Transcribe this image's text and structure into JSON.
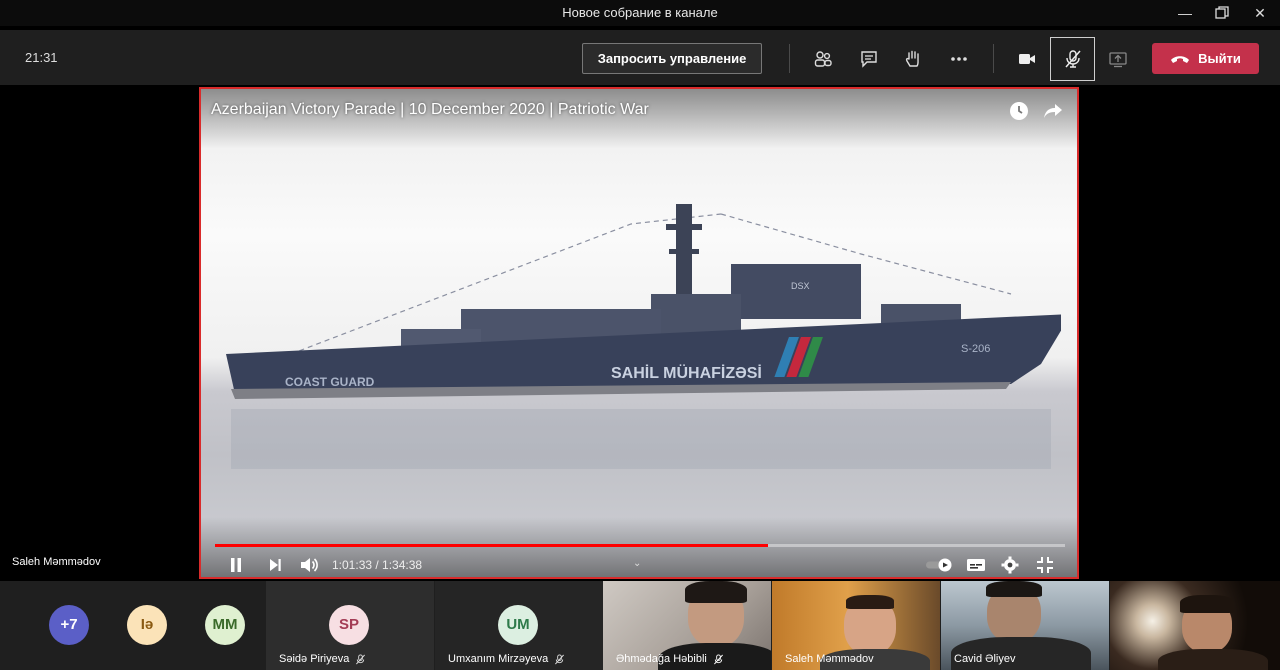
{
  "window": {
    "title": "Новое собрание в канале"
  },
  "toolbar": {
    "time": "21:31",
    "request_control": "Запросить управление",
    "leave": "Выйти"
  },
  "stage": {
    "presenter_name": "Saleh Məmmədov"
  },
  "video": {
    "title": "Azerbaijan Victory Parade | 10 December 2020 | Patriotic War",
    "current_time": "1:01:33",
    "duration": "1:34:38",
    "time_display": "1:01:33 / 1:34:38",
    "progress_fraction": 0.65,
    "ship_text": {
      "hull_main": "SAHİL MÜHAFİZƏSİ",
      "hull_side": "COAST GUARD",
      "pennant": "S-206",
      "bridge_mark": "DSX"
    }
  },
  "participants": {
    "overflow": "+7",
    "avatars": [
      {
        "initials": "Iə",
        "bg": "#fbe3b8",
        "fg": "#8a5a12"
      },
      {
        "initials": "MM",
        "bg": "#dff0d0",
        "fg": "#3b6b2a"
      }
    ],
    "tiles": [
      {
        "initials": "SP",
        "name": "Səidə Piriyeva",
        "bg": "#f7dfe3",
        "fg": "#a33c55",
        "muted": true
      },
      {
        "initials": "UM",
        "name": "Umxanım Mirzəyeva",
        "bg": "#dcefe1",
        "fg": "#2e7a4a",
        "muted": true
      }
    ],
    "camera_tiles": [
      {
        "name": "Əhmədağa Həbibli",
        "muted": true
      },
      {
        "name": "Saleh Məmmədov",
        "muted": false
      },
      {
        "name": "Cavid Əliyev",
        "muted": false
      },
      {
        "name": "",
        "muted": false
      }
    ]
  },
  "colors": {
    "leave": "#c4314b",
    "accent_border": "#d92b2b",
    "progress": "#ff0000",
    "overflow_badge": "#5b5fc7"
  },
  "icons": [
    "people-icon",
    "chat-icon",
    "raise-hand-icon",
    "more-icon",
    "camera-icon",
    "mic-off-icon",
    "share-icon",
    "phone-hangup-icon",
    "watch-later-icon",
    "share-arrow-icon",
    "pause-icon",
    "next-icon",
    "volume-icon",
    "autoplay-toggle-icon",
    "subtitles-icon",
    "settings-icon",
    "exit-fullscreen-icon"
  ]
}
